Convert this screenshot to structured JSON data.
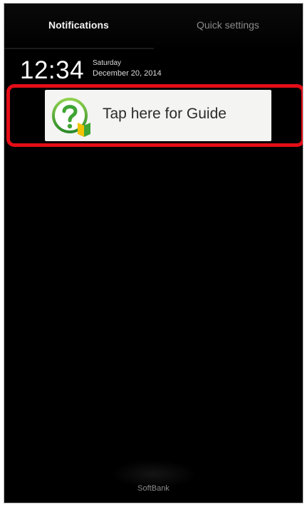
{
  "tabs": {
    "notifications": "Notifications",
    "quick_settings": "Quick settings"
  },
  "clock": {
    "time": "12:34",
    "day": "Saturday",
    "date": "December 20, 2014"
  },
  "guide": {
    "label": "Tap here for Guide",
    "icon": "question-mark-icon"
  },
  "carrier": {
    "name": "SoftBank"
  },
  "colors": {
    "highlight": "#e30d17",
    "background": "#000000",
    "icon_green": "#3fa534"
  }
}
